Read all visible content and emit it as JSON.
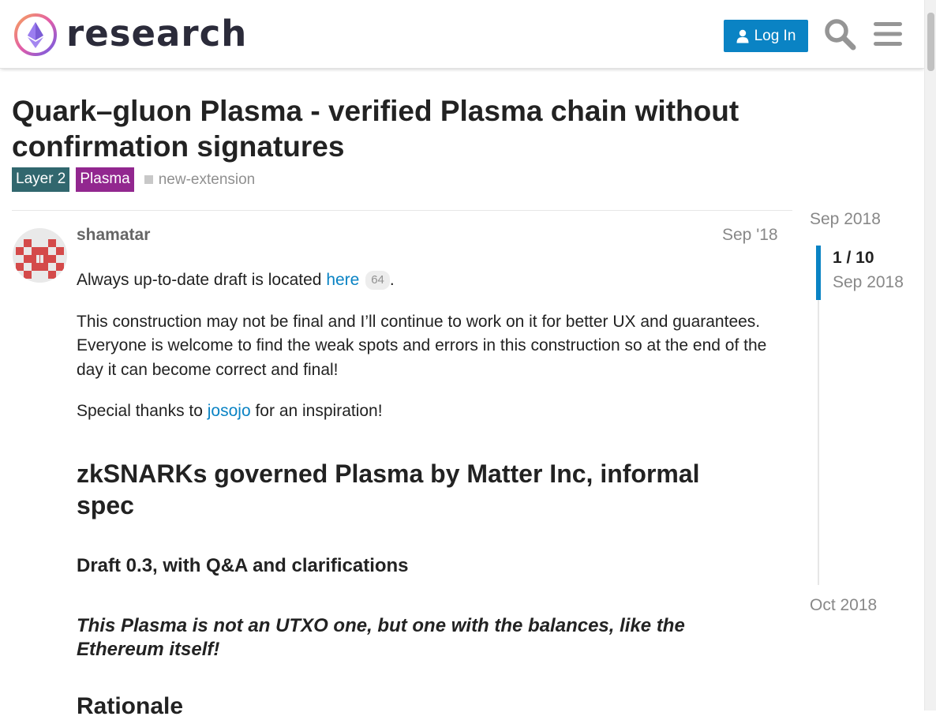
{
  "header": {
    "brand": "research",
    "login_label": "Log In",
    "search_icon": "search-icon",
    "menu_icon": "hamburger-menu-icon",
    "accent_color": "#0a83c4"
  },
  "topic": {
    "title": "Quark–gluon Plasma - verified Plasma chain without confirmation signatures",
    "tags": [
      {
        "label": "Layer 2",
        "color": "#31676e"
      },
      {
        "label": "Plasma",
        "color": "#92278f"
      },
      {
        "label": "new-extension"
      }
    ]
  },
  "post": {
    "author": "shamatar",
    "date": "Sep '18",
    "p1_before": "Always up-to-date draft is located ",
    "p1_link": "here",
    "p1_clicks": "64",
    "p1_after": ".",
    "p2": "This construction may not be final and I’ll continue to work on it for better UX and guarantees. Everyone is welcome to find the weak spots and errors in this construction so at the end of the day it can become correct and final!",
    "p3_before": "Special thanks to ",
    "p3_link": "josojo",
    "p3_after": " for an inspiration!",
    "heading1": "zkSNARKs governed Plasma by Matter Inc, informal spec",
    "heading3": "Draft 0.3, with Q&A and clarifications",
    "emphasis": "This Plasma is not an UTXO one, but one with the balances, like the Ethereum itself!",
    "heading2": "Rationale"
  },
  "timeline": {
    "start": "Sep 2018",
    "position": "1 / 10",
    "position_date": "Sep 2018",
    "end": "Oct 2018"
  }
}
